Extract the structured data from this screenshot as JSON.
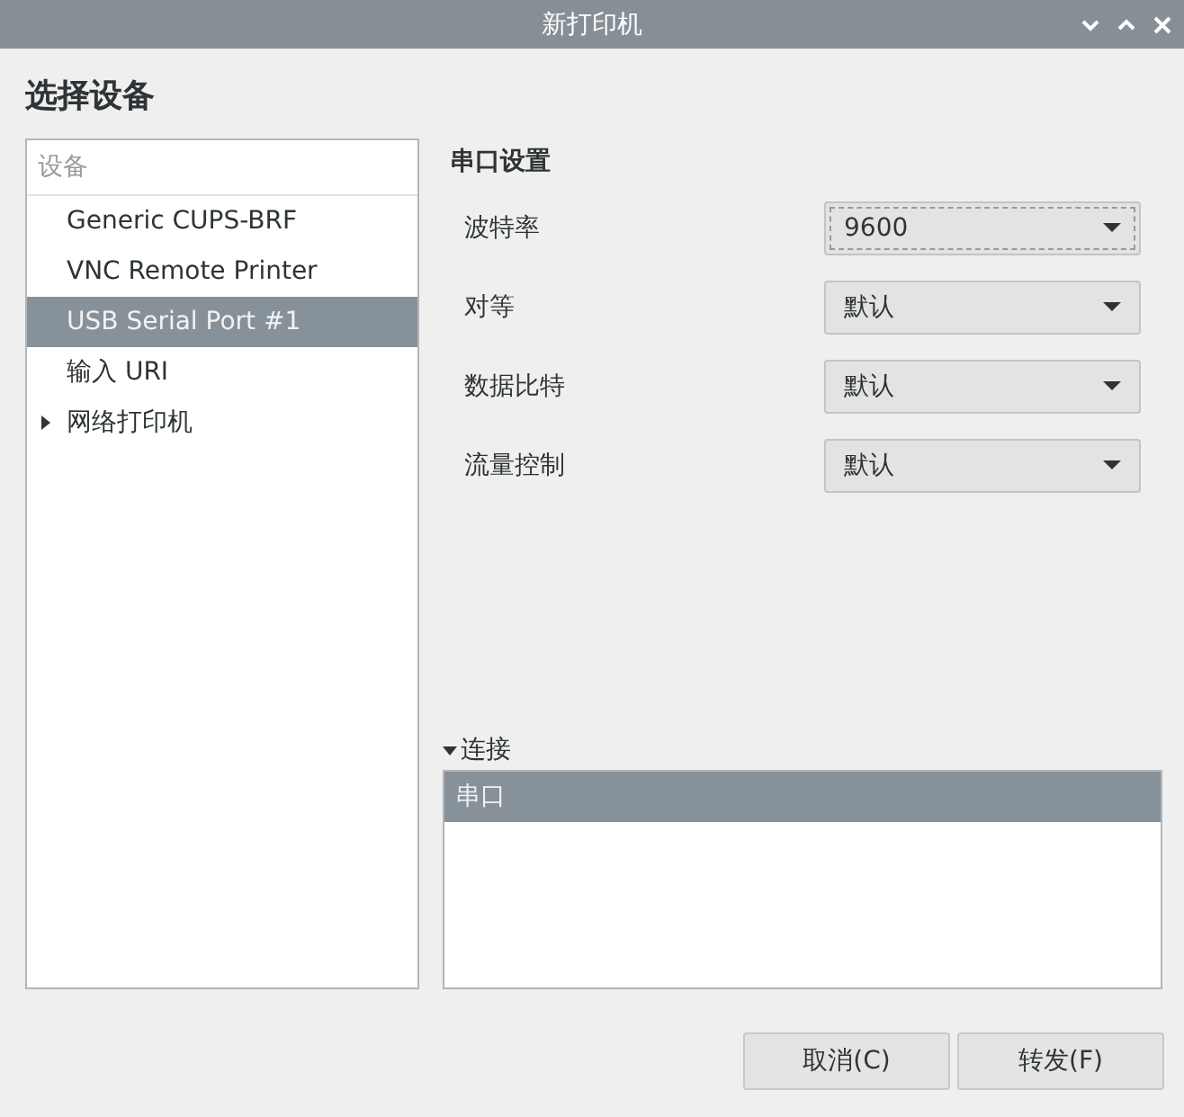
{
  "window": {
    "title": "新打印机"
  },
  "heading": "选择设备",
  "device_list": {
    "header": "设备",
    "items": [
      {
        "label": "Generic CUPS-BRF",
        "selected": false
      },
      {
        "label": "VNC Remote Printer",
        "selected": false
      },
      {
        "label": "USB Serial Port #1",
        "selected": true
      },
      {
        "label": "输入 URI",
        "selected": false
      },
      {
        "label": "网络打印机",
        "selected": false,
        "expanded": false
      }
    ]
  },
  "serial_settings": {
    "title": "串口设置",
    "fields": [
      {
        "label": "波特率",
        "value": "9600",
        "focused": true
      },
      {
        "label": "对等",
        "value": "默认",
        "focused": false
      },
      {
        "label": "数据比特",
        "value": "默认",
        "focused": false
      },
      {
        "label": "流量控制",
        "value": "默认",
        "focused": false
      }
    ]
  },
  "connection": {
    "label": "连接",
    "expanded": true,
    "items": [
      {
        "label": "串口",
        "selected": true
      }
    ]
  },
  "buttons": [
    "取消(C)",
    "转发(F)"
  ]
}
